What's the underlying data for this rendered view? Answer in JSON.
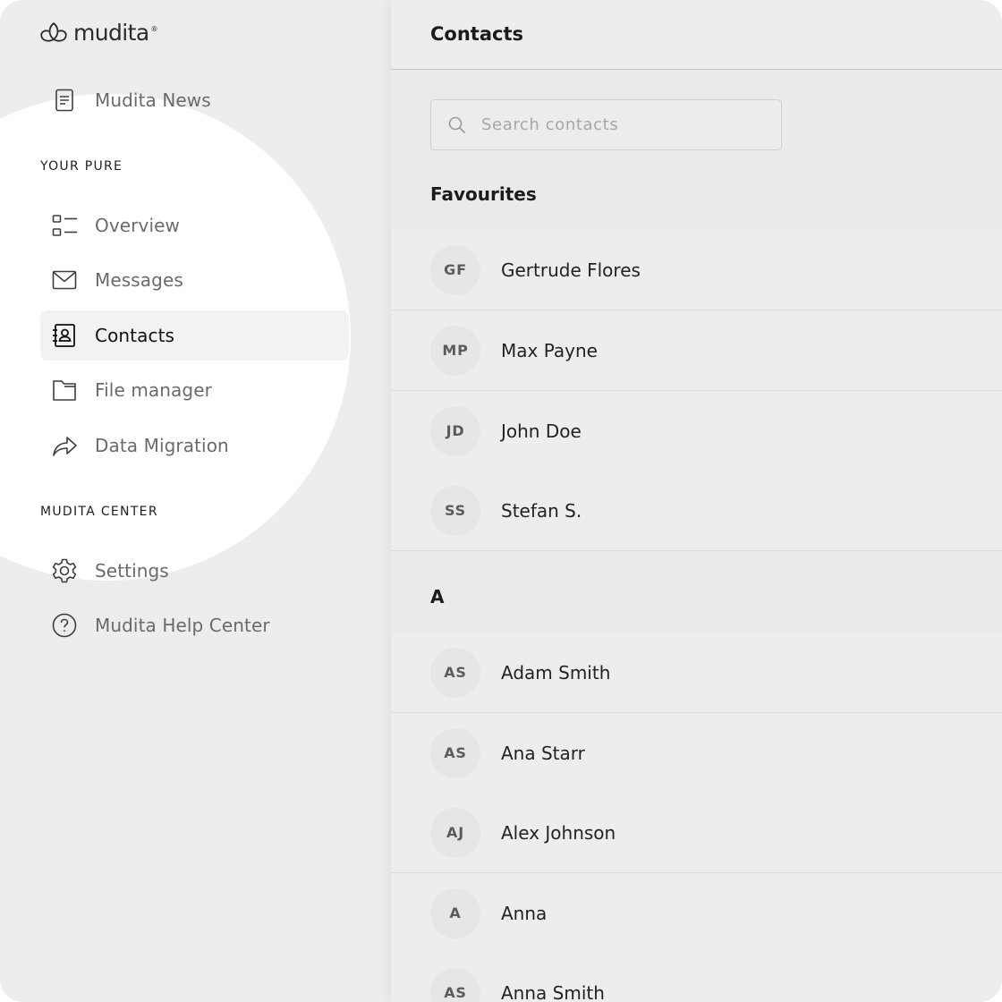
{
  "app": {
    "logo_text": "mudita",
    "logo_mark": "registered"
  },
  "sidebar": {
    "news_item": {
      "label": "Mudita News",
      "icon": "news-icon"
    },
    "section_pure": "YOUR PURE",
    "pure_items": [
      {
        "label": "Overview",
        "icon": "overview-icon"
      },
      {
        "label": "Messages",
        "icon": "envelope-icon"
      },
      {
        "label": "Contacts",
        "icon": "contacts-book-icon",
        "active": true
      },
      {
        "label": "File manager",
        "icon": "folder-icon"
      },
      {
        "label": "Data Migration",
        "icon": "share-arrow-icon"
      }
    ],
    "section_center": "MUDITA CENTER",
    "center_items": [
      {
        "label": "Settings",
        "icon": "gear-icon"
      },
      {
        "label": "Mudita Help Center",
        "icon": "help-icon"
      }
    ]
  },
  "main": {
    "title": "Contacts",
    "search": {
      "placeholder": "Search contacts",
      "value": ""
    },
    "favourites_title": "Favourites",
    "favourites": [
      {
        "initials": "GF",
        "name": "Gertrude Flores"
      },
      {
        "initials": "MP",
        "name": "Max Payne"
      },
      {
        "initials": "JD",
        "name": "John Doe"
      },
      {
        "initials": "SS",
        "name": "Stefan S."
      }
    ],
    "group_a_title": "A",
    "group_a": [
      {
        "initials": "AS",
        "name": "Adam Smith"
      },
      {
        "initials": "AS",
        "name": "Ana Starr"
      },
      {
        "initials": "AJ",
        "name": "Alex Johnson"
      },
      {
        "initials": "A",
        "name": "Anna"
      },
      {
        "initials": "AS",
        "name": "Anna Smith"
      }
    ]
  },
  "colors": {
    "background": "#ededed",
    "spotlight": "#ffffff",
    "active_item": "#f2f2f3",
    "muted_text": "#6a6a6a",
    "avatar_bg": "#e6e6e6"
  }
}
